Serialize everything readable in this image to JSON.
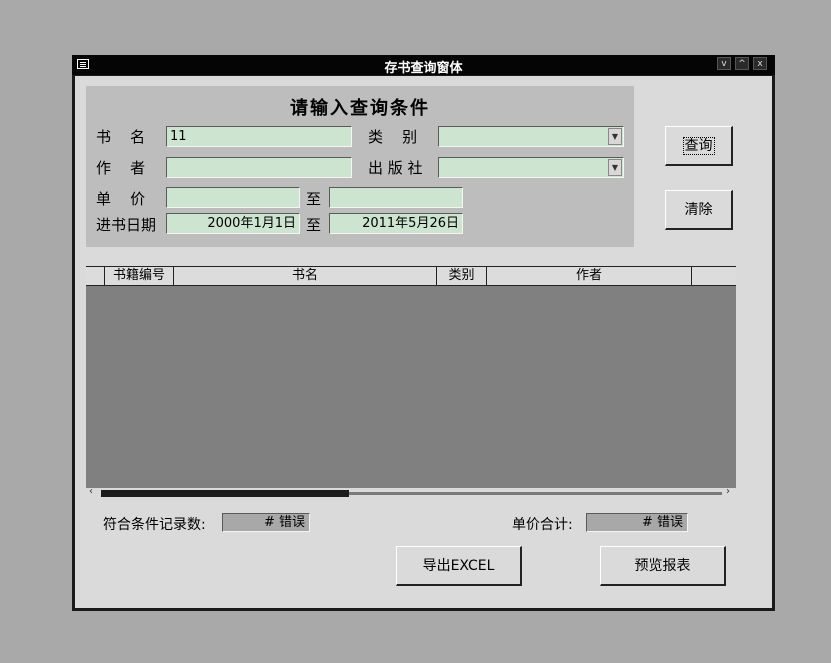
{
  "window": {
    "title": "存书查询窗体",
    "controls": [
      "v",
      "^",
      "x"
    ]
  },
  "panel": {
    "heading": "请输入查询条件",
    "book_name": {
      "label": "书    名",
      "value": "11"
    },
    "category": {
      "label": "类    别",
      "value": ""
    },
    "author": {
      "label": "作    者",
      "value": ""
    },
    "publisher": {
      "label": "出 版 社",
      "value": ""
    },
    "price": {
      "label": "单    价",
      "from": "",
      "to_label": "至",
      "to": ""
    },
    "date": {
      "label": "进书日期",
      "from": "2000年1月1日",
      "to_label": "至",
      "to": "2011年5月26日"
    }
  },
  "buttons": {
    "query": "查询",
    "clear": "清除",
    "export": "导出EXCEL",
    "preview": "预览报表"
  },
  "table": {
    "columns": [
      "书籍编号",
      "书名",
      "类别",
      "作者"
    ]
  },
  "summary": {
    "count_label": "符合条件记录数:",
    "count_value": "# 错误",
    "total_label": "单价合计:",
    "total_value": "# 错误"
  }
}
